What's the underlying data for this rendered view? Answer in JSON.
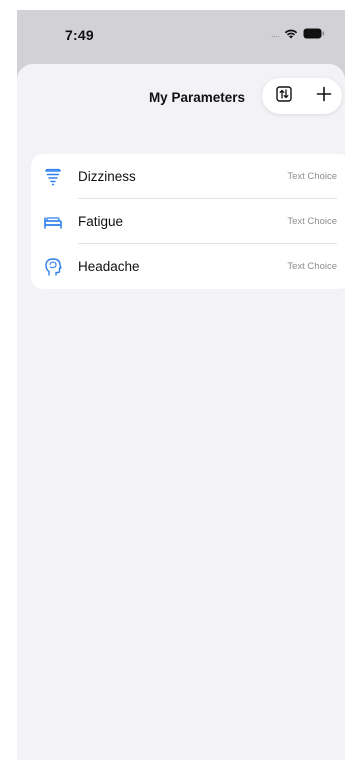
{
  "status_bar": {
    "time": "7:49",
    "signal": "....",
    "icons": [
      "wifi-icon",
      "battery-icon"
    ]
  },
  "nav": {
    "title": "My Parameters",
    "actions": [
      "sort-icon",
      "plus-icon"
    ]
  },
  "parameters": [
    {
      "name": "Dizziness",
      "type": "Text Choice",
      "icon": "tornado-icon"
    },
    {
      "name": "Fatigue",
      "type": "Text Choice",
      "icon": "bed-icon"
    },
    {
      "name": "Headache",
      "type": "Text Choice",
      "icon": "brain-head-icon"
    }
  ],
  "colors": {
    "accent": "#2f80ed",
    "sheet_bg": "#f2f2f7",
    "backdrop": "#d2d2d6",
    "secondary_text": "#8e8e93"
  }
}
